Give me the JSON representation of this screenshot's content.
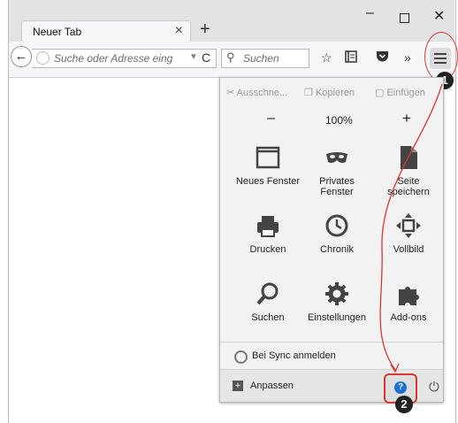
{
  "window": {
    "tab_title": "Neuer Tab",
    "tab_close": "×",
    "new_tab": "+",
    "minimize": "–",
    "close": "✕"
  },
  "toolbar": {
    "back": "←",
    "url_placeholder": "Suche oder Adresse eing",
    "url_drop": "▼",
    "reload": "C",
    "search_placeholder": "Suchen",
    "search_icon": "⚲",
    "bookmark_icon": "☆",
    "overflow": "»"
  },
  "annotations": {
    "badge1": "1",
    "badge2": "2"
  },
  "menu": {
    "edit": {
      "cut": "Ausschne...",
      "copy": "Kopieren",
      "paste": "Einfügen"
    },
    "zoom": {
      "out": "–",
      "value": "100%",
      "in": "+"
    },
    "items": [
      {
        "label": "Neues Fenster",
        "icon": "window-icon"
      },
      {
        "label": "Privates Fenster",
        "icon": "mask-icon"
      },
      {
        "label": "Seite speichern",
        "icon": "page-icon"
      },
      {
        "label": "Drucken",
        "icon": "printer-icon"
      },
      {
        "label": "Chronik",
        "icon": "clock-icon"
      },
      {
        "label": "Vollbild",
        "icon": "fullscreen-icon"
      },
      {
        "label": "Suchen",
        "icon": "search-icon"
      },
      {
        "label": "Einstellungen",
        "icon": "gear-icon"
      },
      {
        "label": "Add-ons",
        "icon": "puzzle-icon"
      }
    ],
    "sync": "Bei Sync anmelden",
    "customize": "Anpassen",
    "help_glyph": "?",
    "power_glyph": "⏻"
  },
  "colors": {
    "accent_red": "#d93636",
    "help_blue": "#1d6fd8"
  }
}
